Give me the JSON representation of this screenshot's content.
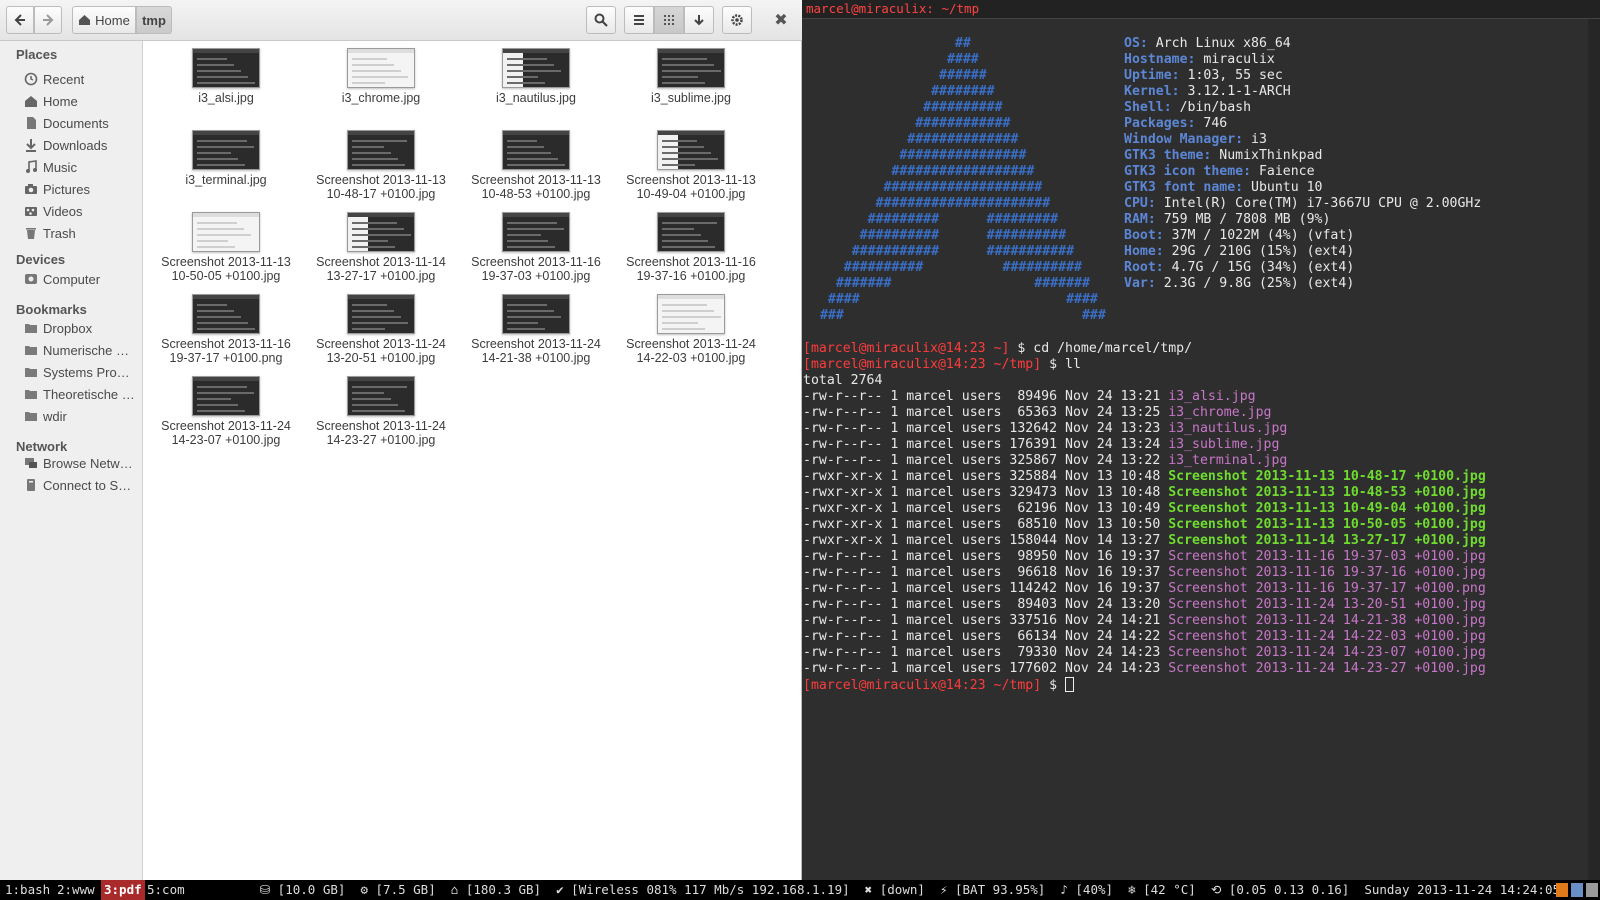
{
  "filemanager": {
    "breadcrumb": {
      "home": "Home",
      "current": "tmp"
    },
    "sidebar": {
      "places_heading": "Places",
      "places": [
        {
          "label": "Recent",
          "icon": "clock-icon"
        },
        {
          "label": "Home",
          "icon": "home-icon"
        },
        {
          "label": "Documents",
          "icon": "document-icon"
        },
        {
          "label": "Downloads",
          "icon": "download-icon"
        },
        {
          "label": "Music",
          "icon": "music-icon"
        },
        {
          "label": "Pictures",
          "icon": "camera-icon"
        },
        {
          "label": "Videos",
          "icon": "video-icon"
        },
        {
          "label": "Trash",
          "icon": "trash-icon"
        }
      ],
      "devices_heading": "Devices",
      "devices": [
        {
          "label": "Computer",
          "icon": "drive-icon"
        }
      ],
      "bookmarks_heading": "Bookmarks",
      "bookmarks": [
        {
          "label": "Dropbox",
          "icon": "folder-icon"
        },
        {
          "label": "Numerische …",
          "icon": "folder-icon"
        },
        {
          "label": "Systems Pro…",
          "icon": "folder-icon"
        },
        {
          "label": "Theoretische …",
          "icon": "folder-icon"
        },
        {
          "label": "wdir",
          "icon": "folder-icon"
        }
      ],
      "network_heading": "Network",
      "network": [
        {
          "label": "Browse Netw…",
          "icon": "network-icon"
        },
        {
          "label": "Connect to S…",
          "icon": "server-icon"
        }
      ]
    },
    "files": [
      {
        "name1": "i3_alsi.jpg",
        "name2": "",
        "style": "dark"
      },
      {
        "name1": "i3_chrome.jpg",
        "name2": "",
        "style": "light"
      },
      {
        "name1": "i3_nautilus.jpg",
        "name2": "",
        "style": "mixed"
      },
      {
        "name1": "i3_sublime.jpg",
        "name2": "",
        "style": "dark"
      },
      {
        "name1": "i3_terminal.jpg",
        "name2": "",
        "style": "dark"
      },
      {
        "name1": "Screenshot 2013-11-13",
        "name2": "10-48-17 +0100.jpg",
        "style": "dark"
      },
      {
        "name1": "Screenshot 2013-11-13",
        "name2": "10-48-53 +0100.jpg",
        "style": "dark"
      },
      {
        "name1": "Screenshot 2013-11-13",
        "name2": "10-49-04 +0100.jpg",
        "style": "mixed"
      },
      {
        "name1": "Screenshot 2013-11-13",
        "name2": "10-50-05 +0100.jpg",
        "style": "light"
      },
      {
        "name1": "Screenshot 2013-11-14",
        "name2": "13-27-17 +0100.jpg",
        "style": "mixed"
      },
      {
        "name1": "Screenshot 2013-11-16",
        "name2": "19-37-03 +0100.jpg",
        "style": "dark"
      },
      {
        "name1": "Screenshot 2013-11-16",
        "name2": "19-37-16 +0100.jpg",
        "style": "dark"
      },
      {
        "name1": "Screenshot 2013-11-16",
        "name2": "19-37-17 +0100.png",
        "style": "dark"
      },
      {
        "name1": "Screenshot 2013-11-24",
        "name2": "13-20-51 +0100.jpg",
        "style": "dark"
      },
      {
        "name1": "Screenshot 2013-11-24",
        "name2": "14-21-38 +0100.jpg",
        "style": "dark"
      },
      {
        "name1": "Screenshot 2013-11-24",
        "name2": "14-22-03 +0100.jpg",
        "style": "light"
      },
      {
        "name1": "Screenshot 2013-11-24",
        "name2": "14-23-07 +0100.jpg",
        "style": "dark"
      },
      {
        "name1": "Screenshot 2013-11-24",
        "name2": "14-23-27 +0100.jpg",
        "style": "dark"
      }
    ]
  },
  "terminal": {
    "title": "marcel@miraculix: ~/tmp",
    "art": [
      "                  ##",
      "                 ####",
      "                ######",
      "               ########",
      "              ##########",
      "             ############",
      "            ##############",
      "           ################",
      "          ##################",
      "         ####################",
      "        ######################",
      "       #########      #########",
      "      ##########      ##########",
      "     ###########      ###########",
      "    ##########          ##########",
      "   #######                  #######",
      "  ####                          ####",
      " ###                              ###"
    ],
    "info": [
      {
        "k": "OS:",
        "v": " Arch Linux x86_64"
      },
      {
        "k": "Hostname:",
        "v": " miraculix"
      },
      {
        "k": "Uptime:",
        "v": " 1:03, 55 sec"
      },
      {
        "k": "Kernel:",
        "v": " 3.12.1-1-ARCH"
      },
      {
        "k": "Shell:",
        "v": " /bin/bash"
      },
      {
        "k": "Packages:",
        "v": " 746"
      },
      {
        "k": "Window Manager:",
        "v": " i3"
      },
      {
        "k": "GTK3 theme:",
        "v": " NumixThinkpad"
      },
      {
        "k": "GTK3 icon theme:",
        "v": " Faience"
      },
      {
        "k": "GTK3 font name:",
        "v": " Ubuntu 10"
      },
      {
        "k": "CPU:",
        "v": " Intel(R) Core(TM) i7-3667U CPU @ 2.00GHz"
      },
      {
        "k": "RAM:",
        "v": " 759 MB / 7808 MB (9%)"
      },
      {
        "k": "Boot:",
        "v": " 37M / 1022M (4%) (vfat)"
      },
      {
        "k": "Home:",
        "v": " 29G / 210G (15%) (ext4)"
      },
      {
        "k": "Root:",
        "v": " 4.7G / 15G (34%) (ext4)"
      },
      {
        "k": "Var:",
        "v": " 2.3G / 9.8G (25%) (ext4)"
      }
    ],
    "commands": [
      {
        "prompt": "[marcel@miraculix@14:23 ~]",
        "cmd": " $ cd /home/marcel/tmp/"
      },
      {
        "prompt": "[marcel@miraculix@14:23 ~/tmp]",
        "cmd": " $ ll"
      }
    ],
    "total": "total 2764",
    "listing": [
      {
        "meta": "-rw-r--r-- 1 marcel users  89496 Nov 24 13:21 ",
        "file": "i3_alsi.jpg",
        "exec": false
      },
      {
        "meta": "-rw-r--r-- 1 marcel users  65363 Nov 24 13:25 ",
        "file": "i3_chrome.jpg",
        "exec": false
      },
      {
        "meta": "-rw-r--r-- 1 marcel users 132642 Nov 24 13:23 ",
        "file": "i3_nautilus.jpg",
        "exec": false
      },
      {
        "meta": "-rw-r--r-- 1 marcel users 176391 Nov 24 13:24 ",
        "file": "i3_sublime.jpg",
        "exec": false
      },
      {
        "meta": "-rw-r--r-- 1 marcel users 325867 Nov 24 13:22 ",
        "file": "i3_terminal.jpg",
        "exec": false
      },
      {
        "meta": "-rwxr-xr-x 1 marcel users 325884 Nov 13 10:48 ",
        "file": "Screenshot 2013-11-13 10-48-17 +0100.jpg",
        "exec": true
      },
      {
        "meta": "-rwxr-xr-x 1 marcel users 329473 Nov 13 10:48 ",
        "file": "Screenshot 2013-11-13 10-48-53 +0100.jpg",
        "exec": true
      },
      {
        "meta": "-rwxr-xr-x 1 marcel users  62196 Nov 13 10:49 ",
        "file": "Screenshot 2013-11-13 10-49-04 +0100.jpg",
        "exec": true
      },
      {
        "meta": "-rwxr-xr-x 1 marcel users  68510 Nov 13 10:50 ",
        "file": "Screenshot 2013-11-13 10-50-05 +0100.jpg",
        "exec": true
      },
      {
        "meta": "-rwxr-xr-x 1 marcel users 158044 Nov 14 13:27 ",
        "file": "Screenshot 2013-11-14 13-27-17 +0100.jpg",
        "exec": true
      },
      {
        "meta": "-rw-r--r-- 1 marcel users  98950 Nov 16 19:37 ",
        "file": "Screenshot 2013-11-16 19-37-03 +0100.jpg",
        "exec": false
      },
      {
        "meta": "-rw-r--r-- 1 marcel users  96618 Nov 16 19:37 ",
        "file": "Screenshot 2013-11-16 19-37-16 +0100.jpg",
        "exec": false
      },
      {
        "meta": "-rw-r--r-- 1 marcel users 114242 Nov 16 19:37 ",
        "file": "Screenshot 2013-11-16 19-37-17 +0100.png",
        "exec": false
      },
      {
        "meta": "-rw-r--r-- 1 marcel users  89403 Nov 24 13:20 ",
        "file": "Screenshot 2013-11-24 13-20-51 +0100.jpg",
        "exec": false
      },
      {
        "meta": "-rw-r--r-- 1 marcel users 337516 Nov 24 14:21 ",
        "file": "Screenshot 2013-11-24 14-21-38 +0100.jpg",
        "exec": false
      },
      {
        "meta": "-rw-r--r-- 1 marcel users  66134 Nov 24 14:22 ",
        "file": "Screenshot 2013-11-24 14-22-03 +0100.jpg",
        "exec": false
      },
      {
        "meta": "-rw-r--r-- 1 marcel users  79330 Nov 24 14:23 ",
        "file": "Screenshot 2013-11-24 14-23-07 +0100.jpg",
        "exec": false
      },
      {
        "meta": "-rw-r--r-- 1 marcel users 177602 Nov 24 14:23 ",
        "file": "Screenshot 2013-11-24 14-23-27 +0100.jpg",
        "exec": false
      }
    ],
    "final_prompt": "[marcel@miraculix@14:23 ~/tmp]",
    "final_cmd": " $ "
  },
  "i3bar": {
    "workspaces": [
      "1:bash",
      "2:www",
      "3:pdf",
      "5:com"
    ],
    "active_workspace": "3:pdf",
    "status": "⛁ [10.0 GB]  ⚙ [7.5 GB]  ⌂ [180.3 GB]  ✔ [Wireless 081% 117 Mb/s 192.168.1.19]  ✖ [down]  ⚡ [BAT 93.95%]  ♪ [40%]  ❄ [42 °C]  ⟲ [0.05 0.13 0.16]  Sunday 2013-11-24 14:24:05"
  },
  "colors": {
    "prompt": "#ff3c3c",
    "image_file": "#c777c7",
    "exec_file": "#6fdc2f",
    "arch_blue": "#3a6fc7",
    "active_workspace": "#a82a2a"
  }
}
